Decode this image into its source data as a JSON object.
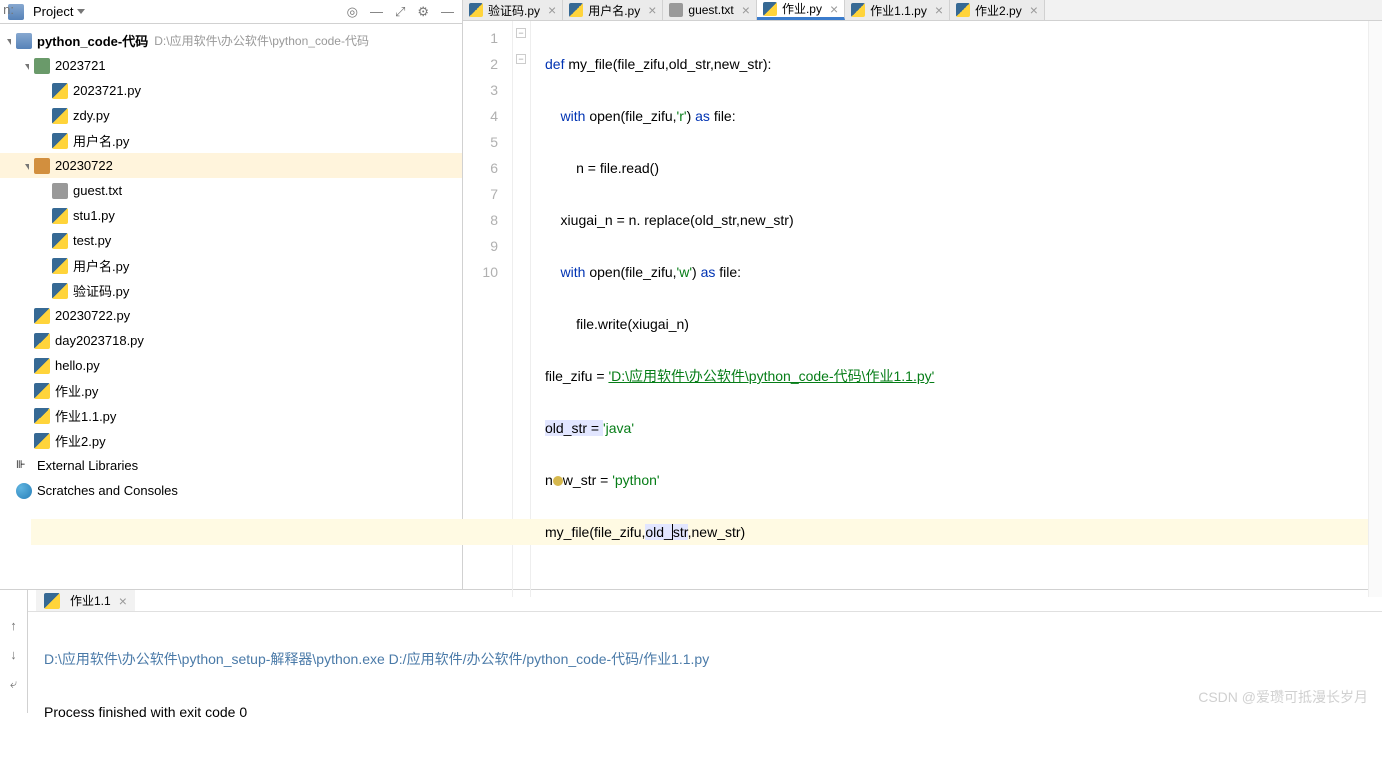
{
  "project": {
    "header_label": "Project",
    "root_name": "python_code-代码",
    "root_path": "D:\\应用软件\\办公软件\\python_code-代码",
    "tree": [
      {
        "indent": 0,
        "type": "project",
        "name": "python_code-代码",
        "path": "D:\\应用软件\\办公软件\\python_code-代码",
        "expanded": true
      },
      {
        "indent": 1,
        "type": "folder",
        "name": "2023721",
        "expanded": true
      },
      {
        "indent": 2,
        "type": "py",
        "name": "2023721.py"
      },
      {
        "indent": 2,
        "type": "py",
        "name": "zdy.py"
      },
      {
        "indent": 2,
        "type": "py",
        "name": "用户名.py"
      },
      {
        "indent": 1,
        "type": "folder-open",
        "name": "20230722",
        "expanded": true,
        "selected": true
      },
      {
        "indent": 2,
        "type": "txt",
        "name": "guest.txt"
      },
      {
        "indent": 2,
        "type": "py",
        "name": "stu1.py"
      },
      {
        "indent": 2,
        "type": "py",
        "name": "test.py"
      },
      {
        "indent": 2,
        "type": "py",
        "name": "用户名.py"
      },
      {
        "indent": 2,
        "type": "py",
        "name": "验证码.py"
      },
      {
        "indent": 1,
        "type": "py",
        "name": "20230722.py"
      },
      {
        "indent": 1,
        "type": "py",
        "name": "day2023718.py"
      },
      {
        "indent": 1,
        "type": "py",
        "name": "hello.py"
      },
      {
        "indent": 1,
        "type": "py",
        "name": "作业.py"
      },
      {
        "indent": 1,
        "type": "py",
        "name": "作业1.1.py"
      },
      {
        "indent": 1,
        "type": "py",
        "name": "作业2.py"
      },
      {
        "indent": 0,
        "type": "lib",
        "name": "External Libraries"
      },
      {
        "indent": 0,
        "type": "scratch",
        "name": "Scratches and Consoles"
      }
    ]
  },
  "tabs": [
    {
      "icon": "py",
      "label": "验证码.py",
      "active": false
    },
    {
      "icon": "py",
      "label": "用户名.py",
      "active": false
    },
    {
      "icon": "txt",
      "label": "guest.txt",
      "active": false
    },
    {
      "icon": "py",
      "label": "作业.py",
      "active": true
    },
    {
      "icon": "py",
      "label": "作业1.1.py",
      "active": false
    },
    {
      "icon": "py",
      "label": "作业2.py",
      "active": false
    }
  ],
  "code": {
    "lines": [
      "1",
      "2",
      "3",
      "4",
      "5",
      "6",
      "7",
      "8",
      "9",
      "10"
    ],
    "l1_def": "def ",
    "l1_fn": "my_file",
    "l1_rest": "(file_zifu,old_str,new_str):",
    "l2_with": "    with ",
    "l2_open": "open",
    "l2_p1": "(file_zifu,",
    "l2_s": "'r'",
    "l2_p2": ") ",
    "l2_as": "as ",
    "l2_f": "file:",
    "l3": "        n = file.read()",
    "l4": "    xiugai_n = n. replace(old_str,new_str)",
    "l5_with": "    with ",
    "l5_open": "open",
    "l5_p1": "(file_zifu,",
    "l5_s": "'w'",
    "l5_p2": ") ",
    "l5_as": "as ",
    "l5_f": "file:",
    "l6": "        file.write(xiugai_n)",
    "l7_a": "file_zifu = ",
    "l7_s": "'D:\\应用软件\\办公软件\\python_code-代码\\作业1.1.py'",
    "l8_a": "old_str = ",
    "l8_s": "'java'",
    "l9_a": "n",
    "l9_b": "w_str = ",
    "l9_s": "'python'",
    "l10_a": "my_file(file_zifu,",
    "l10_sel": "old_",
    "l10_b": "str",
    "l10_c": ",new_str)"
  },
  "console": {
    "left_label": "n:",
    "tab_label": "作业1.1",
    "out_line1": "D:\\应用软件\\办公软件\\python_setup-解释器\\python.exe D:/应用软件/办公软件/python_code-代码/作业1.1.py",
    "out_line2": "Process finished with exit code 0"
  },
  "watermark": "CSDN @爱瓒可抵漫长岁月"
}
